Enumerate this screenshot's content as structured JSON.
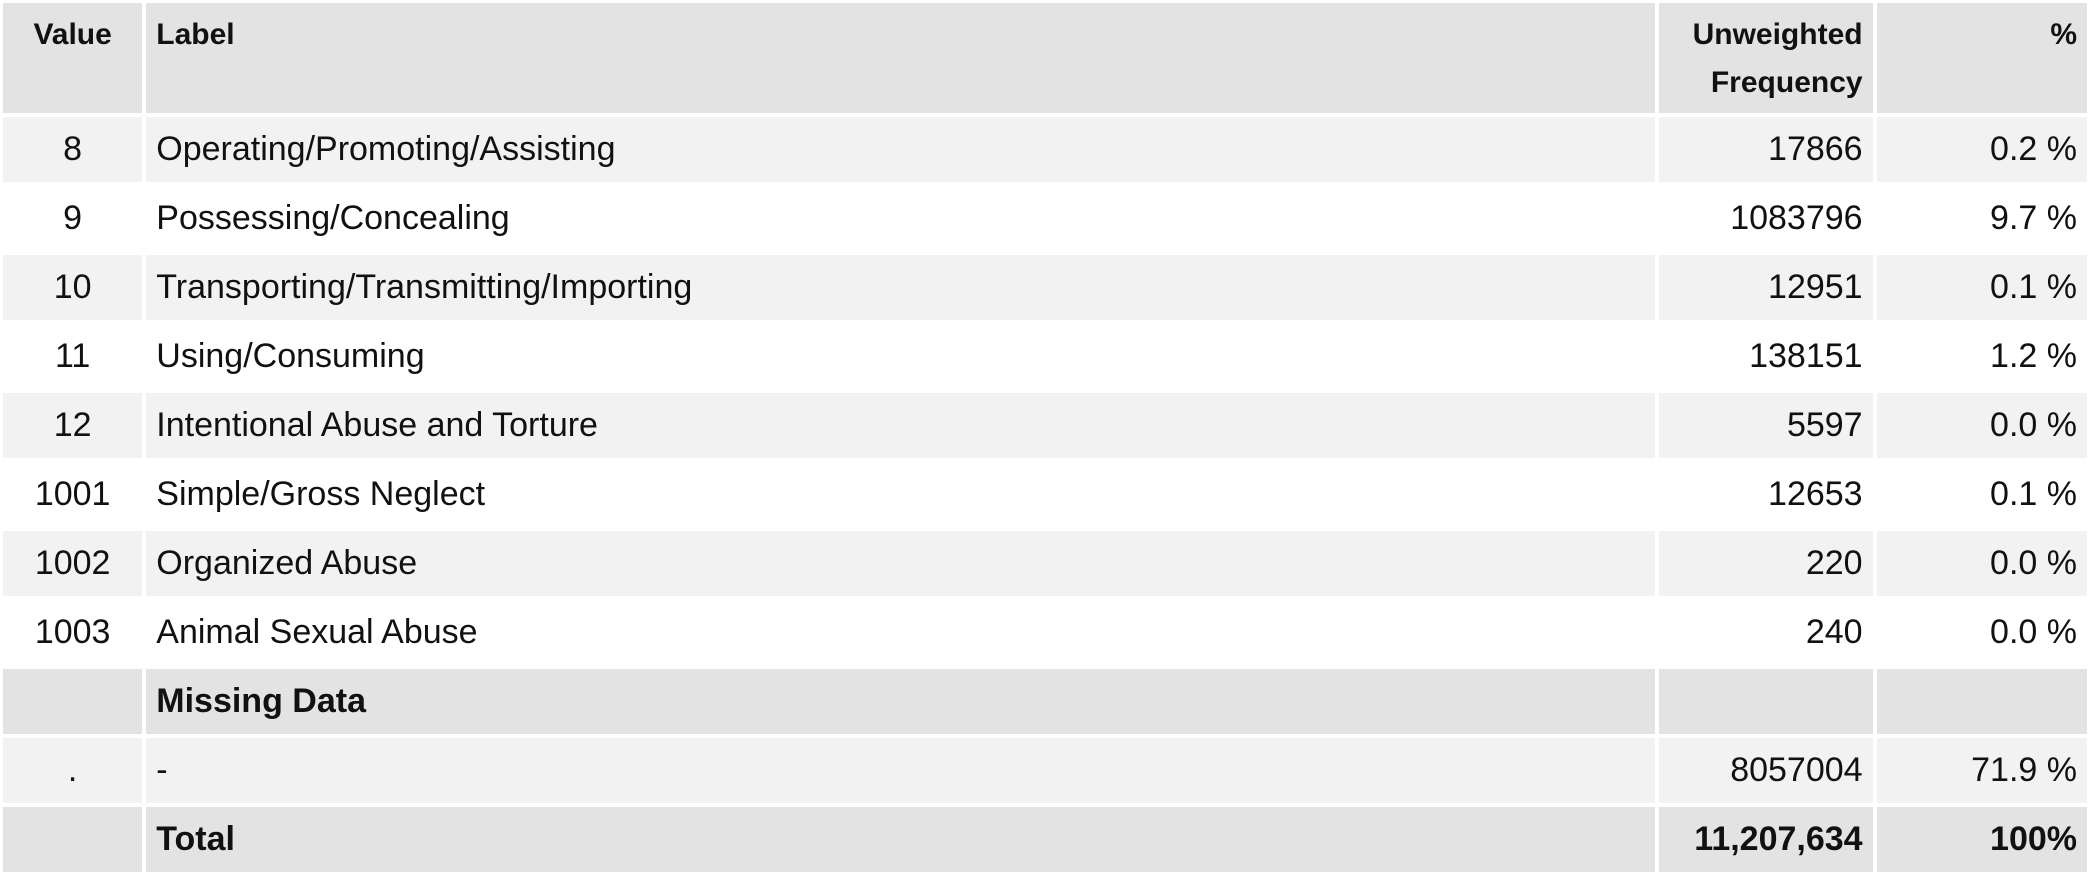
{
  "headers": {
    "value": "Value",
    "label": "Label",
    "freq_line1": "Unweighted",
    "freq_line2": "Frequency",
    "percent": "%"
  },
  "rows": [
    {
      "value": "8",
      "label": "Operating/Promoting/Assisting",
      "freq": "17866",
      "pct": "0.2 %"
    },
    {
      "value": "9",
      "label": "Possessing/Concealing",
      "freq": "1083796",
      "pct": "9.7 %"
    },
    {
      "value": "10",
      "label": "Transporting/Transmitting/Importing",
      "freq": "12951",
      "pct": "0.1 %"
    },
    {
      "value": "11",
      "label": "Using/Consuming",
      "freq": "138151",
      "pct": "1.2 %"
    },
    {
      "value": "12",
      "label": "Intentional Abuse and Torture",
      "freq": "5597",
      "pct": "0.0 %"
    },
    {
      "value": "1001",
      "label": "Simple/Gross Neglect",
      "freq": "12653",
      "pct": "0.1 %"
    },
    {
      "value": "1002",
      "label": "Organized Abuse",
      "freq": "220",
      "pct": "0.0 %"
    },
    {
      "value": "1003",
      "label": "Animal Sexual Abuse",
      "freq": "240",
      "pct": "0.0 %"
    }
  ],
  "missing_section": {
    "label": "Missing Data"
  },
  "missing_rows": [
    {
      "value": ".",
      "label": "-",
      "freq": "8057004",
      "pct": "71.9 %"
    }
  ],
  "total": {
    "label": "Total",
    "freq": "11,207,634",
    "pct": "100%"
  }
}
